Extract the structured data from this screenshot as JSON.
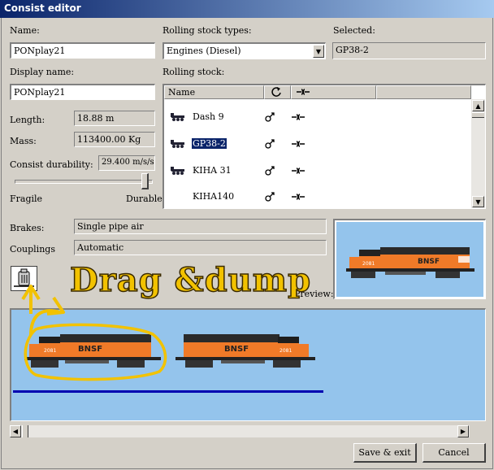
{
  "window": {
    "title": "Consist editor"
  },
  "labels": {
    "name": "Name:",
    "display_name": "Display name:",
    "rolling_stock_types": "Rolling stock types:",
    "selected": "Selected:",
    "rolling_stock": "Rolling stock:",
    "length": "Length:",
    "mass": "Mass:",
    "durability": "Consist durability:",
    "fragile": "Fragile",
    "durable": "Durable",
    "brakes": "Brakes:",
    "couplings": "Couplings",
    "preview": "Preview:"
  },
  "fields": {
    "name": "PONplay21",
    "display_name": "PONplay21",
    "rolling_stock_type": "Engines (Diesel)",
    "selected": "GP38-2",
    "length": "18.88 m",
    "mass": "113400.00 Kg",
    "durability": "29.400 m/s/s",
    "durability_level": 0.98,
    "brakes": "Single pipe air",
    "couplings": "Automatic"
  },
  "rolling_stock": {
    "columns": [
      "Name",
      "reverser-icon",
      "coupler-icon"
    ],
    "items": [
      {
        "name": "Dash 9",
        "selected": false
      },
      {
        "name": "GP38-2",
        "selected": true
      },
      {
        "name": "KIHA 31",
        "selected": false
      },
      {
        "name": "KIHA140",
        "selected": false
      }
    ]
  },
  "annotation": {
    "text": "Drag &dump",
    "color": "#f2c200"
  },
  "consist": {
    "locos": [
      {
        "road": "BNSF",
        "number": "2081",
        "highlighted": true
      },
      {
        "road": "BNSF",
        "number": "2081",
        "highlighted": false
      }
    ]
  },
  "preview": {
    "road": "BNSF",
    "number": "2081"
  },
  "buttons": {
    "save_exit": "Save & exit",
    "cancel": "Cancel"
  },
  "colors": {
    "title_bar": "#0a246a",
    "selection": "#0a246a",
    "consist_bg": "#94c4ec",
    "track_line": "#0000b0",
    "loco_orange": "#f07a28"
  }
}
